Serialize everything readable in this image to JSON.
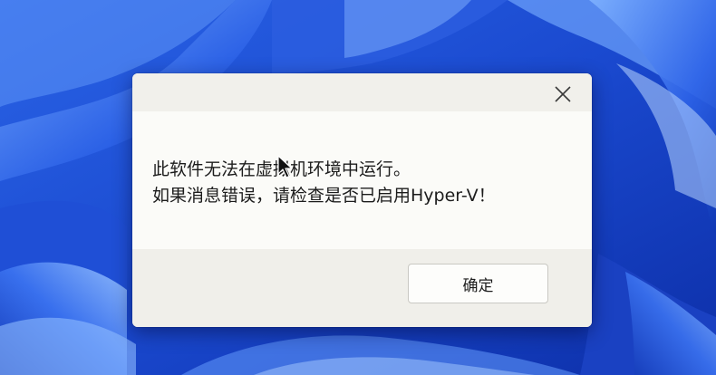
{
  "dialog": {
    "message_line1": "此软件无法在虚拟机环境中运行。",
    "message_line2": "如果消息错误，请检查是否已启用Hyper-V！",
    "ok_label": "确定",
    "close_icon": "close-icon"
  },
  "colors": {
    "wallpaper_base": "#1846c9",
    "dialog_background": "#f2f1ec",
    "content_background": "#fbfbf8"
  }
}
